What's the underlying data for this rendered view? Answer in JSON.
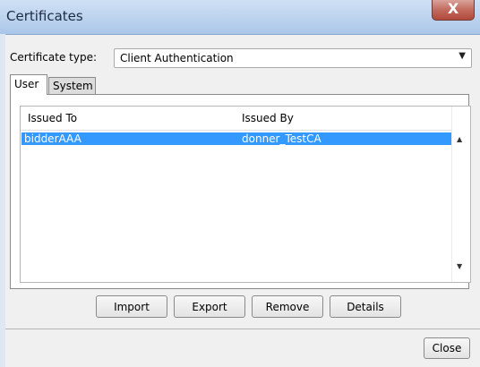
{
  "window": {
    "title": "Certificates",
    "close_glyph": "X"
  },
  "certificate_type": {
    "label": "Certificate type:",
    "selected": "Client Authentication",
    "arrow": "▼"
  },
  "tabs": [
    {
      "label": "User",
      "active": true
    },
    {
      "label": "System",
      "active": false
    }
  ],
  "table": {
    "columns": [
      "Issued To",
      "Issued By"
    ],
    "rows": [
      {
        "issued_to": "bidderAAA",
        "issued_by": "donner_TestCA",
        "selected": true
      }
    ],
    "scroll_up": "▲",
    "scroll_down": "▼"
  },
  "buttons": {
    "import": "Import",
    "export": "Export",
    "remove": "Remove",
    "details": "Details",
    "close": "Close"
  },
  "colors": {
    "selection": "#3399ff",
    "title_bar": "#bcd3ee"
  }
}
